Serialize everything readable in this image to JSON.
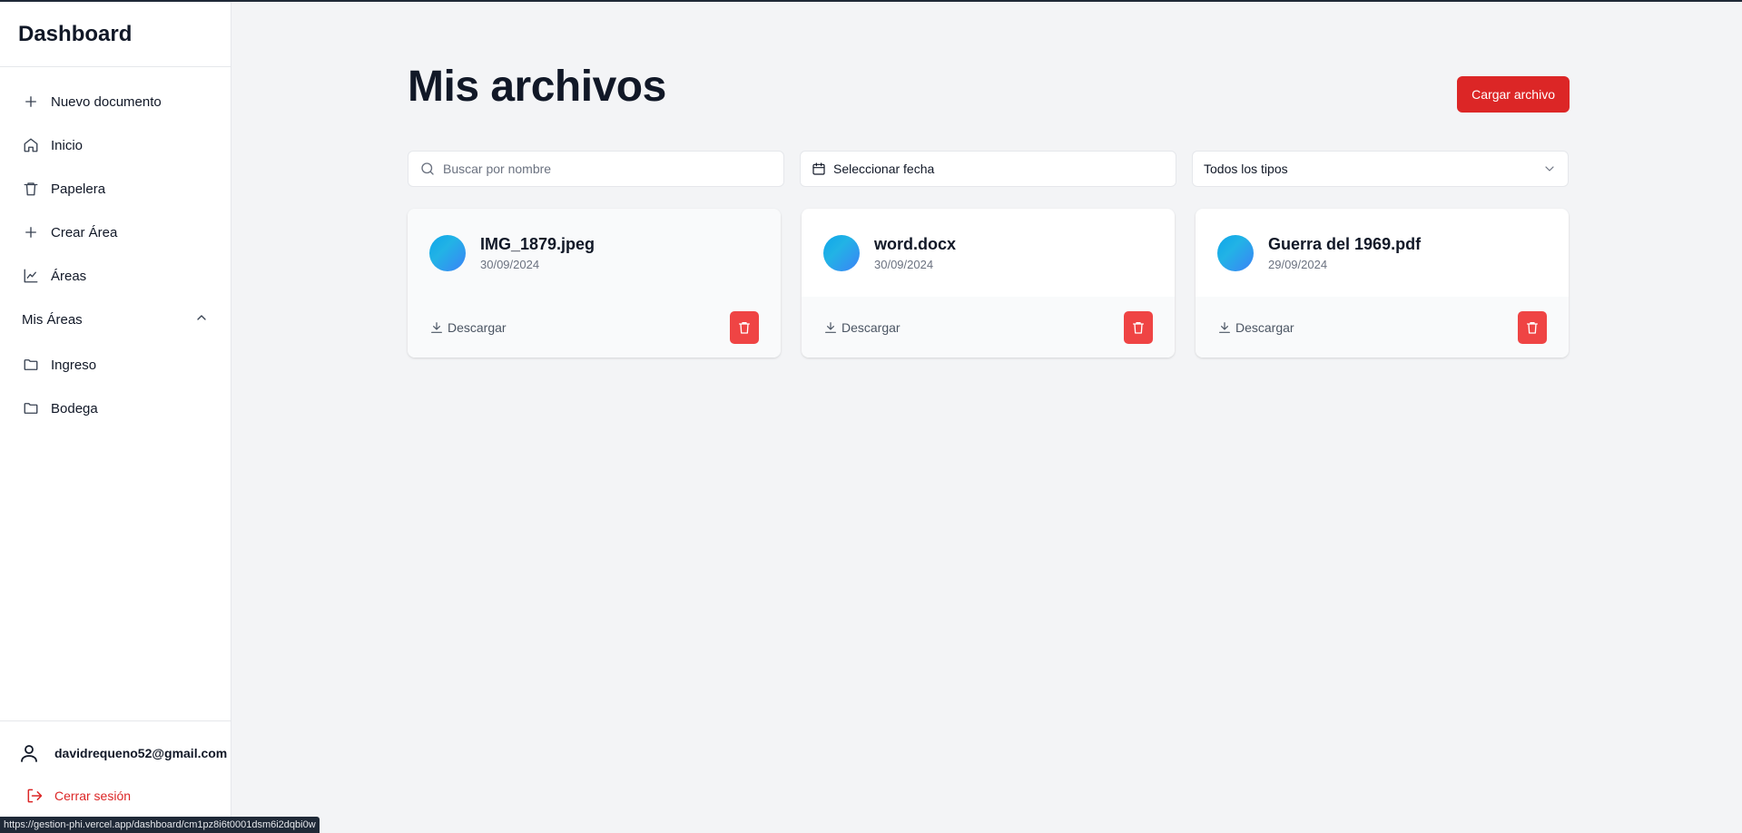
{
  "sidebar": {
    "title": "Dashboard",
    "items": [
      {
        "label": "Nuevo documento",
        "icon": "plus-icon"
      },
      {
        "label": "Inicio",
        "icon": "home-icon"
      },
      {
        "label": "Papelera",
        "icon": "trash-icon"
      },
      {
        "label": "Crear Área",
        "icon": "plus-icon"
      },
      {
        "label": "Áreas",
        "icon": "chart-icon"
      }
    ],
    "section": {
      "label": "Mis Áreas",
      "icon": "chevron-up-icon"
    },
    "areas": [
      {
        "label": "Ingreso",
        "icon": "folder-icon"
      },
      {
        "label": "Bodega",
        "icon": "folder-icon"
      }
    ],
    "user_email": "davidrequeno52@gmail.com",
    "logout_label": "Cerrar sesión"
  },
  "main": {
    "title": "Mis archivos",
    "upload_label": "Cargar archivo",
    "search_placeholder": "Buscar por nombre",
    "date_label": "Seleccionar fecha",
    "type_label": "Todos los tipos",
    "files": [
      {
        "name": "IMG_1879.jpeg",
        "date": "30/09/2024",
        "download_label": "Descargar"
      },
      {
        "name": "word.docx",
        "date": "30/09/2024",
        "download_label": "Descargar"
      },
      {
        "name": "Guerra del 1969.pdf",
        "date": "29/09/2024",
        "download_label": "Descargar"
      }
    ]
  },
  "status_url": "https://gestion-phi.vercel.app/dashboard/cm1pz8i6t0001dsm6i2dqbi0w",
  "colors": {
    "accent": "#dc2626",
    "delete": "#ef4444",
    "background": "#f3f4f6"
  }
}
